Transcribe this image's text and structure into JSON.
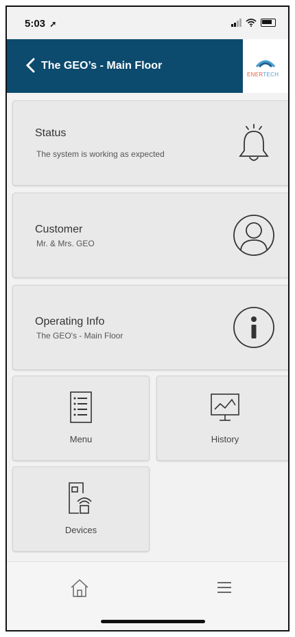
{
  "status_bar": {
    "time": "5:03",
    "location_arrow": "➚"
  },
  "header": {
    "title": "The GEO’s - Main Floor",
    "back_icon": "chevron-left-icon"
  },
  "logo": {
    "text_a": "ENER",
    "text_b": "TECH"
  },
  "cards": {
    "status": {
      "title": "Status",
      "subtitle": "The system is working as expected",
      "icon": "bell-icon"
    },
    "customer": {
      "title": "Customer",
      "subtitle": "Mr. & Mrs. GEO",
      "icon": "user-icon"
    },
    "operating": {
      "title": "Operating Info",
      "subtitle": "The GEO's - Main Floor",
      "icon": "info-icon"
    }
  },
  "tiles": {
    "menu": {
      "label": "Menu",
      "icon": "list-icon"
    },
    "history": {
      "label": "History",
      "icon": "chart-icon"
    },
    "devices": {
      "label": "Devices",
      "icon": "device-wifi-icon"
    }
  },
  "nav": {
    "home_icon": "home-icon",
    "menu_icon": "hamburger-icon"
  },
  "colors": {
    "header_bg": "#0c4a6e",
    "card_bg": "#e9e9e9",
    "page_bg": "#f2f2f2"
  }
}
